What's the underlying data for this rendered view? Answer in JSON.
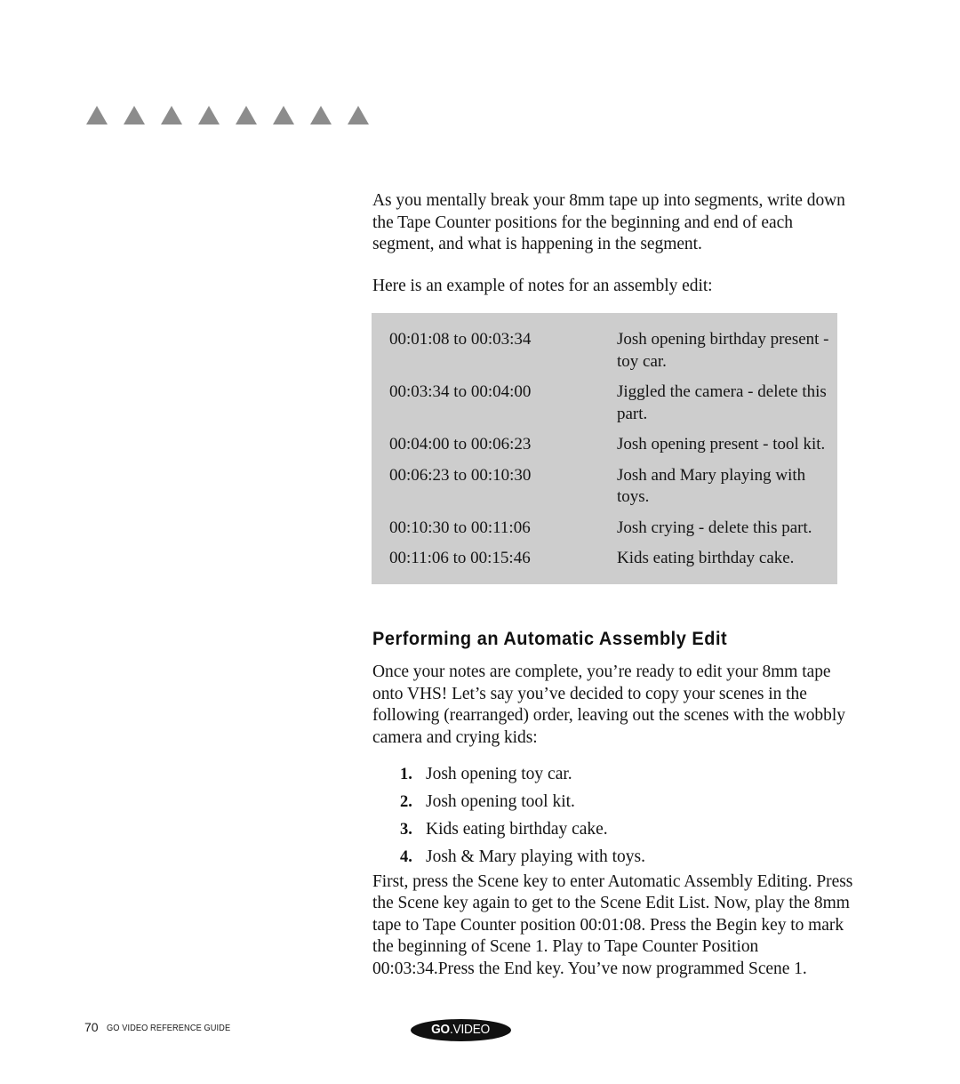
{
  "decor": {
    "triangle_count": 8,
    "triangle_color": "#8c8c8c"
  },
  "intro": {
    "paragraph_1": "As you mentally break your 8mm tape up into segments, write down the Tape Counter positions for the beginning and end of each segment, and what is happening in the segment.",
    "paragraph_2": "Here is an example of notes for an assembly edit:"
  },
  "notes_table": {
    "background_color": "#cdcdcd",
    "rows": [
      {
        "time": "00:01:08 to 00:03:34",
        "description": "Josh opening birthday present - toy car."
      },
      {
        "time": "00:03:34 to 00:04:00",
        "description": "Jiggled the camera - delete this part."
      },
      {
        "time": "00:04:00 to 00:06:23",
        "description": "Josh opening present - tool kit."
      },
      {
        "time": "00:06:23 to 00:10:30",
        "description": "Josh and Mary playing with toys."
      },
      {
        "time": "00:10:30 to 00:11:06",
        "description": "Josh crying - delete this part."
      },
      {
        "time": "00:11:06 to 00:15:46",
        "description": "Kids eating birthday cake."
      }
    ]
  },
  "section": {
    "heading": "Performing an Automatic Assembly Edit",
    "intro_paragraph": "Once your notes are complete, you’re ready to edit your 8mm tape onto VHS! Let’s say you’ve decided to copy your scenes in the following (rearranged) order, leaving out the scenes with the wobbly camera and crying kids:",
    "steps": [
      {
        "number": "1.",
        "text": "Josh opening toy car."
      },
      {
        "number": "2.",
        "text": "Josh opening tool kit."
      },
      {
        "number": "3.",
        "text": "Kids eating birthday cake."
      },
      {
        "number": "4.",
        "text": "Josh & Mary playing with toys."
      }
    ],
    "closing_paragraph": "First, press the Scene key to enter Automatic Assembly Editing. Press the Scene key again to get to the Scene Edit List. Now, play the 8mm tape to Tape Counter position 00:01:08. Press the Begin key to mark the beginning of Scene 1. Play to Tape Counter Position 00:03:34.Press the End key. You’ve now programmed Scene 1."
  },
  "footer": {
    "page_number": "70",
    "guide_label": "GO VIDEO REFERENCE GUIDE",
    "logo_primary": "GO",
    "logo_secondary": ".VIDEO",
    "logo_background": "#111111"
  }
}
